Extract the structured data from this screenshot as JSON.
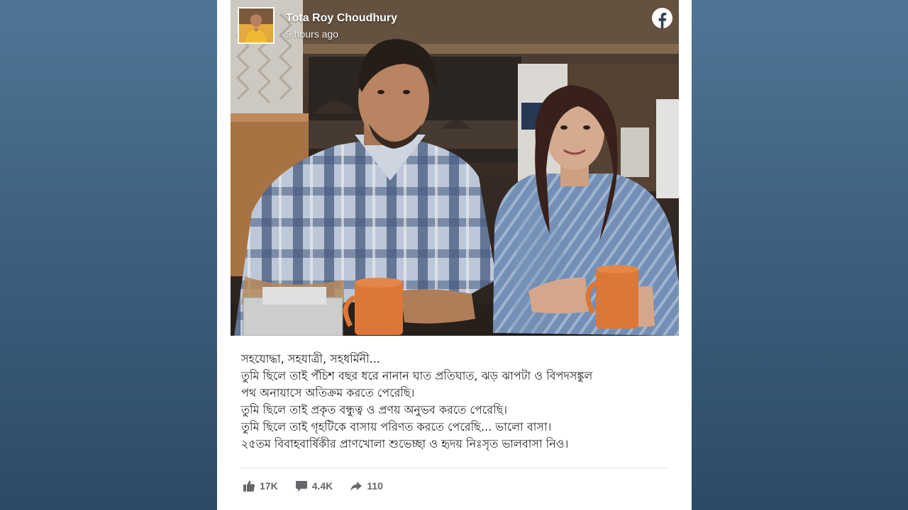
{
  "post": {
    "author": "Tota Roy Choudhury",
    "time": "9 hours ago",
    "caption_lines": [
      "সহযোদ্ধা, সহযাত্রী, সহধর্মিনী...",
      "তুমি ছিলে তাই পঁচিশ বছর ধরে নানান ঘাত প্রতিঘাত, ঝড় ঝাপটা ও বিপদসঙ্কুল",
      "পথ অনায়াসে অতিক্রম করতে পেরেছি।",
      "তুমি ছিলে তাই প্রকৃত বন্ধুত্ব ও প্রণয় অনুভব করতে পেরেছি।",
      "তুমি ছিলে তাই গৃহটিকে বাসায় পরিণত করতে পেরেছি... ভালো বাসা।",
      "২৫তম বিবাহবার্ষিকীর প্রাণখোলা শুভেচ্ছা ও হৃদয় নিঃসৃত ভালবাসা নিও।"
    ],
    "likes": "17K",
    "comments": "4.4K",
    "shares": "110"
  },
  "icons": {
    "platform": "facebook-icon",
    "like": "thumbs-up-icon",
    "comment": "comment-icon",
    "share": "share-arrow-icon"
  },
  "colors": {
    "background": "#3f6180",
    "facebook_brand": "#ffffff",
    "stat_text": "#65676b",
    "caption_text": "#1c1e21"
  }
}
